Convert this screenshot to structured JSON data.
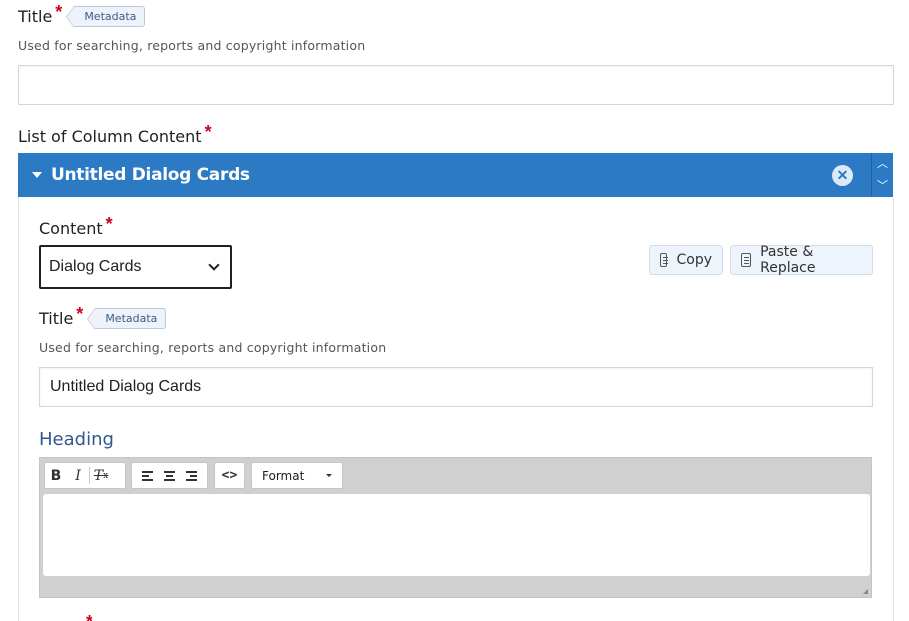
{
  "top_field": {
    "label": "Title",
    "required_mark": "*",
    "tag": "Metadata",
    "description": "Used for searching, reports and copyright information",
    "value": ""
  },
  "list_field": {
    "label": "List of Column Content",
    "required_mark": "*"
  },
  "panel": {
    "title": "Untitled Dialog Cards",
    "close_icon": "close-icon",
    "move_up_icon": "chevron-up-icon",
    "move_down_icon": "chevron-down-icon",
    "accent_color": "#2d7ac4"
  },
  "content_field": {
    "label": "Content",
    "required_mark": "*",
    "selected": "Dialog Cards",
    "copy_label": "Copy",
    "paste_label": "Paste & Replace"
  },
  "inner_title": {
    "label": "Title",
    "required_mark": "*",
    "tag": "Metadata",
    "description": "Used for searching, reports and copyright information",
    "value": "Untitled Dialog Cards"
  },
  "heading_field": {
    "label": "Heading",
    "toolbar": {
      "bold": "B",
      "italic": "I",
      "clear_format": "Tx",
      "source": "<>",
      "format_label": "Format"
    },
    "value": ""
  }
}
